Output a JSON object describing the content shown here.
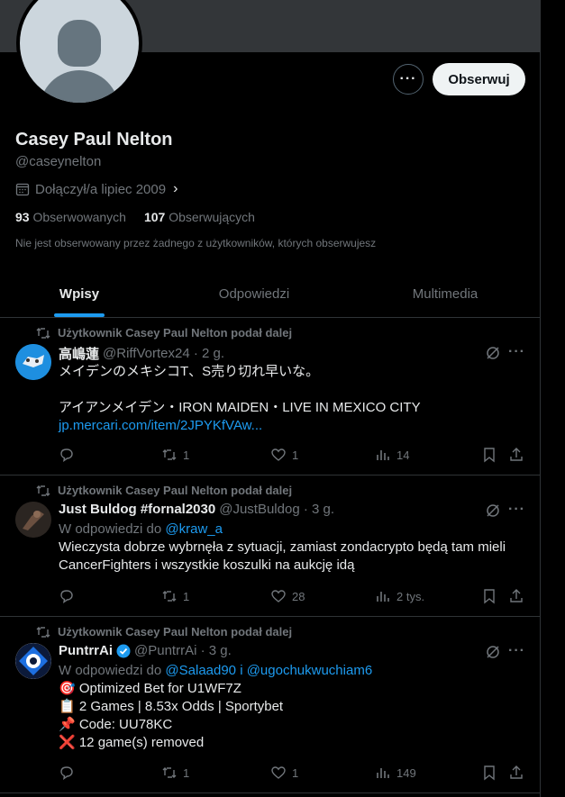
{
  "profile": {
    "name": "Casey Paul Nelton",
    "handle": "@caseynelton",
    "joined": "Dołączył/a lipiec 2009",
    "following_count": "93",
    "following_label": "Obserwowanych",
    "followers_count": "107",
    "followers_label": "Obserwujących",
    "not_followed_text": "Nie jest obserwowany przez żadnego z użytkowników, których obserwujesz",
    "follow_label": "Obserwuj",
    "more_label": "···"
  },
  "tabs": [
    {
      "label": "Wpisy",
      "active": true
    },
    {
      "label": "Odpowiedzi",
      "active": false
    },
    {
      "label": "Multimedia",
      "active": false
    }
  ],
  "posts": [
    {
      "repost_label": "Użytkownik Casey Paul Nelton podał dalej",
      "name": "高嶋蓮",
      "meta": "@RiffVortex24 · 2 g.",
      "line1": "メイデンのメキシコT、S売り切れ早いな。",
      "line2": "アイアンメイデン・IRON MAIDEN・LIVE IN MEXICO CITY",
      "link": "jp.mercari.com/item/2JPYKfVAw...",
      "replies": "",
      "reposts": "1",
      "likes": "1",
      "views": "14"
    },
    {
      "repost_label": "Użytkownik Casey Paul Nelton podał dalej",
      "name": "Just Buldog #fornal2030",
      "meta": "@JustBuldog · 3 g.",
      "reply_prefix": "W odpowiedzi do ",
      "reply_to": "@kraw_a",
      "text": "Wieczysta dobrze wybrnęła z sytuacji, zamiast zondacrypto będą tam mieli CancerFighters i wszystkie koszulki na aukcję idą",
      "replies": "",
      "reposts": "1",
      "likes": "28",
      "views": "2 tys."
    },
    {
      "repost_label": "Użytkownik Casey Paul Nelton podał dalej",
      "name": "PuntrrAi",
      "meta": "@PuntrrAi · 3 g.",
      "reply_prefix": "W odpowiedzi do ",
      "reply_to": "@Salaad90 i @ugochukwuchiam6",
      "lines": [
        "🎯 Optimized Bet for U1WF7Z",
        "📋 2 Games | 8.53x Odds | Sportybet",
        "📌 Code: UU78KC",
        "❌ 12 game(s) removed"
      ],
      "replies": "",
      "reposts": "1",
      "likes": "1",
      "views": "149"
    }
  ],
  "icons": {
    "calendar": "calendar-icon",
    "retweet": "retweet-icon",
    "verified": "verified-badge-icon",
    "grok": "grok-icon",
    "reply": "reply-icon",
    "like": "heart-icon",
    "views": "views-icon",
    "bookmark": "bookmark-icon",
    "share": "share-icon"
  },
  "colors": {
    "background": "#000000",
    "text": "#e7e9ea",
    "muted": "#71767b",
    "accent": "#1d9bf0",
    "border": "#2f3336",
    "follow_button": "#eff3f4"
  }
}
